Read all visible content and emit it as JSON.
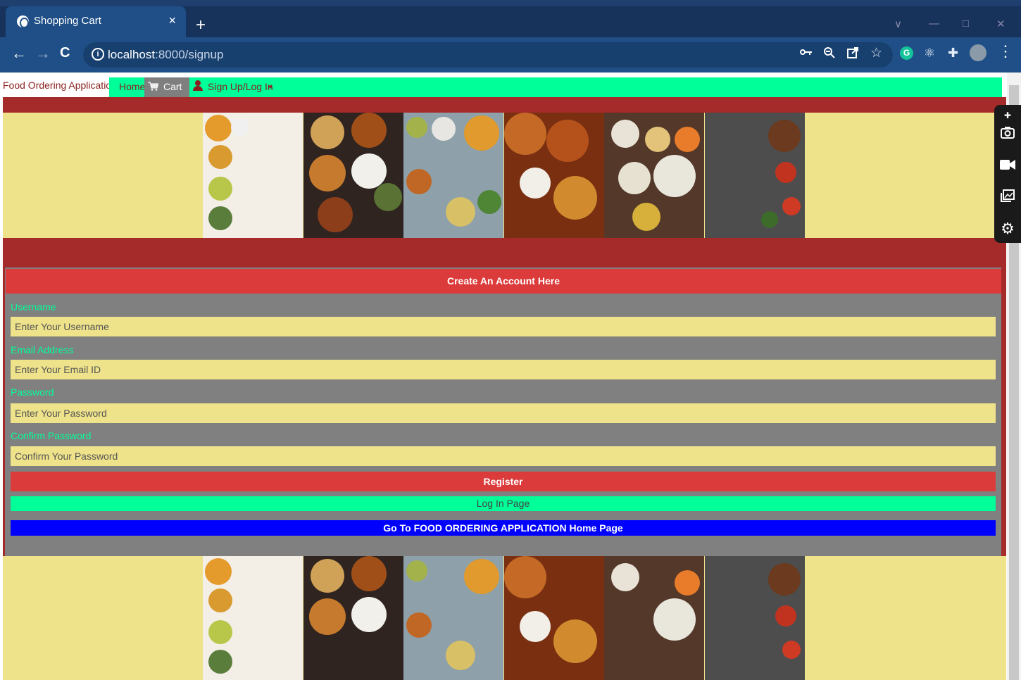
{
  "browser": {
    "tab_title": "Shopping Cart",
    "tab_close": "×",
    "new_tab": "+",
    "url_host": "localhost",
    "url_path": ":8000/signup",
    "back": "←",
    "forward": "→",
    "reload": "C",
    "info": "i",
    "window_controls": [
      "∨",
      "—",
      "□",
      "✕"
    ],
    "menu": "⋮",
    "extension_g": "G"
  },
  "site_nav": {
    "brand": "Food Ordering Application",
    "home": "Home",
    "cart": "Cart",
    "signup_login": "Sign Up/Log In",
    "colors": {
      "nav_accent": "#00ff99",
      "brand_color": "#8b1e1e"
    }
  },
  "form": {
    "header": "Create An Account Here",
    "fields": [
      {
        "label": "Username",
        "placeholder": "Enter Your Username"
      },
      {
        "label": "Email Address",
        "placeholder": "Enter Your Email ID"
      },
      {
        "label": "Password",
        "placeholder": "Enter Your Password"
      },
      {
        "label": "Confirm Password",
        "placeholder": "Confirm Your Password"
      }
    ],
    "register_label": "Register",
    "login_label": "Log In Page",
    "home_label": "Go To FOOD ORDERING APPLICATION Home Page"
  },
  "colors": {
    "page_band": "#a52a2a",
    "banner_bg": "#eee28a",
    "form_bg": "#808080",
    "header_red": "#dc3b3b",
    "input_bg": "#eee28a",
    "label_green": "#00ff99",
    "home_blue": "#0000ff"
  }
}
